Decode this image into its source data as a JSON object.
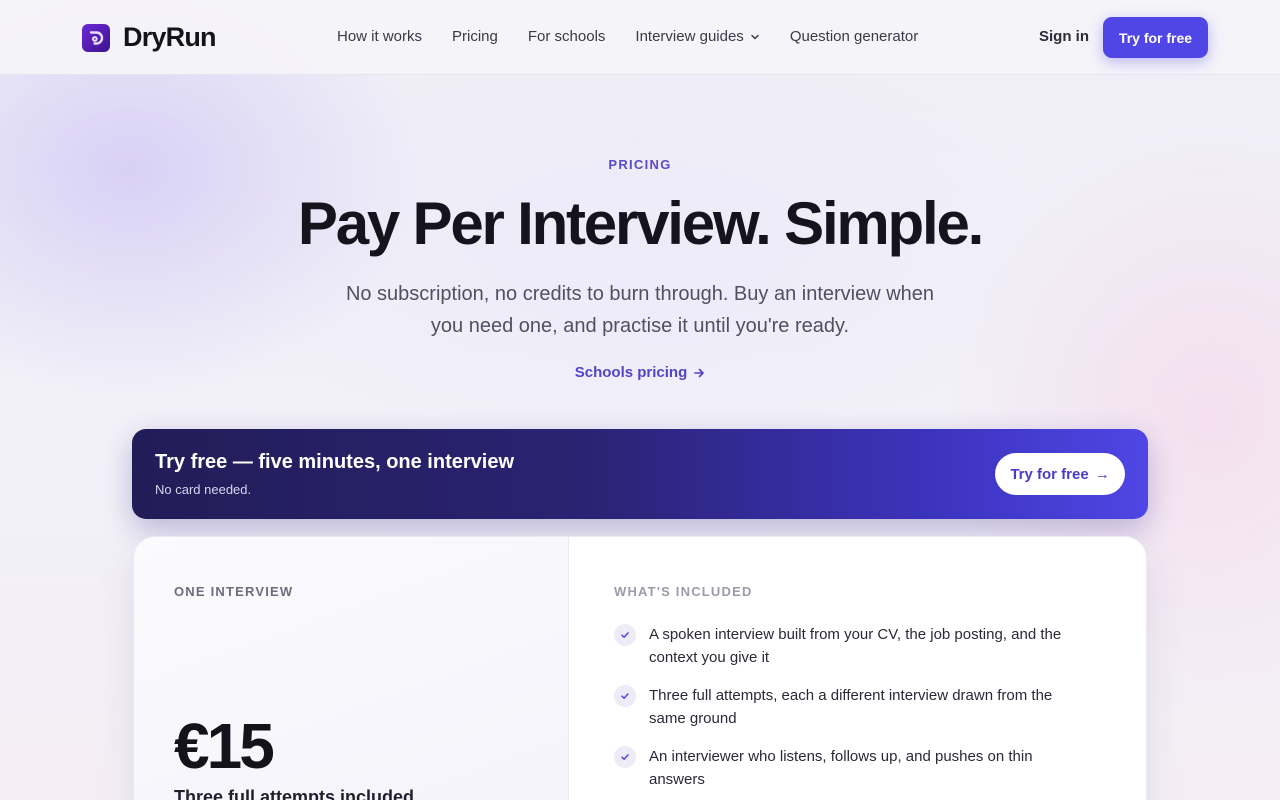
{
  "brand": {
    "name": "DryRun",
    "accent": "#4f46e5"
  },
  "nav": {
    "items": [
      {
        "label": "How it works"
      },
      {
        "label": "Pricing"
      },
      {
        "label": "For schools"
      },
      {
        "label": "Interview guides",
        "icon": "chevron-down-icon"
      },
      {
        "label": "Question generator"
      }
    ],
    "sign_in": "Sign in",
    "cta": "Try for free"
  },
  "hero": {
    "eyebrow": "PRICING",
    "title": "Pay Per Interview. Simple.",
    "subtitle": "No subscription, no credits to burn through. Buy an interview when you need one, and practise it until you're ready.",
    "schools_link": "Schools pricing"
  },
  "banner": {
    "title": "Try free — five minutes, one interview",
    "subtitle": "No card needed.",
    "cta": "Try for free",
    "cta_arrow": "→"
  },
  "plan": {
    "label": "ONE INTERVIEW",
    "price": "€15",
    "note": "Three full attempts included",
    "included_label": "WHAT'S INCLUDED",
    "features": [
      "A spoken interview built from your CV, the job posting, and the context you give it",
      "Three full attempts, each a different interview drawn from the same ground",
      "An interviewer who listens, follows up, and pushes on thin answers"
    ]
  }
}
